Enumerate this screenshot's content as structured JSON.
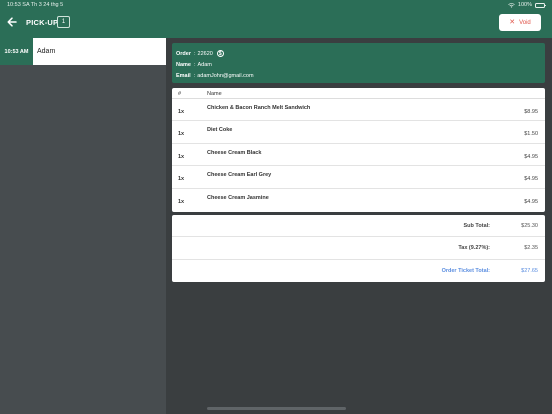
{
  "status_bar": {
    "time_date": "10:53 SA  Th 3 24 thg 5",
    "battery": "100%"
  },
  "header": {
    "title": "PICK-UP",
    "count": "1",
    "void_label": "Void"
  },
  "sidebar": {
    "orders": [
      {
        "time": "10:53 AM",
        "name": "Adam"
      }
    ]
  },
  "order_info": {
    "order_label": "Order",
    "order_number": "22620",
    "name_label": "Name",
    "name_value": "Adam",
    "email_label": "Email",
    "email_value": "adamJohn@gmail.com",
    "separator": ":"
  },
  "items_table": {
    "headers": {
      "qty": "#",
      "name": "Name"
    },
    "rows": [
      {
        "qty": "1x",
        "name": "Chicken & Bacon Ranch Melt Sandwich",
        "price": "$8.95"
      },
      {
        "qty": "1x",
        "name": "Diet Coke",
        "price": "$1.50"
      },
      {
        "qty": "1x",
        "name": "Cheese Cream Black",
        "price": "$4.95"
      },
      {
        "qty": "1x",
        "name": "Cheese Cream Earl Grey",
        "price": "$4.95"
      },
      {
        "qty": "1x",
        "name": "Cheese Cream Jasmine",
        "price": "$4.95"
      }
    ]
  },
  "totals": {
    "subtotal_label": "Sub Total:",
    "subtotal_value": "$25.30",
    "tax_label": "Tax (9.27%):",
    "tax_value": "$2.35",
    "grand_label": "Order Ticket Total:",
    "grand_value": "$27.65"
  },
  "colors": {
    "primary": "#2b6e57",
    "background": "#3a3e40",
    "sidebar": "#474c4f",
    "danger": "#e0554a",
    "accent": "#5a8de0"
  },
  "icons": [
    "back-arrow-icon",
    "close-icon",
    "info-icon",
    "wifi-icon",
    "battery-icon"
  ]
}
